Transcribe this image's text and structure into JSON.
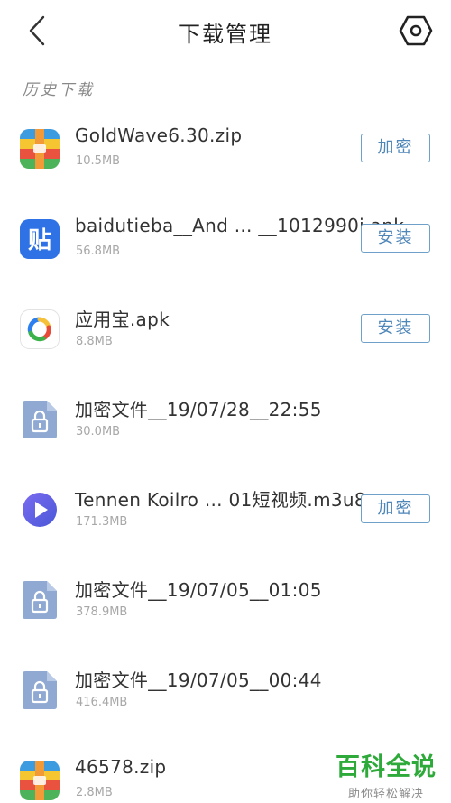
{
  "header": {
    "title": "下载管理",
    "back_icon": "chevron-left-icon",
    "settings_icon": "hexagon-settings-icon"
  },
  "section": {
    "label": "历史下载"
  },
  "files": [
    {
      "name": "GoldWave6.30.zip",
      "size": "10.5MB",
      "icon": "archive-icon",
      "action": "加密"
    },
    {
      "name": "baidutieba__And ... __1012990i.apk",
      "size": "56.8MB",
      "icon": "tieba-icon",
      "action": "安装"
    },
    {
      "name": "应用宝.apk",
      "size": "8.8MB",
      "icon": "yingyongbao-icon",
      "action": "安装"
    },
    {
      "name": "加密文件__19/07/28__22:55",
      "size": "30.0MB",
      "icon": "locked-file-icon",
      "action": ""
    },
    {
      "name": "Tennen Koilro ... 01短视频.m3u8",
      "size": "171.3MB",
      "icon": "video-play-icon",
      "action": "加密"
    },
    {
      "name": "加密文件__19/07/05__01:05",
      "size": "378.9MB",
      "icon": "locked-file-icon",
      "action": ""
    },
    {
      "name": "加密文件__19/07/05__00:44",
      "size": "416.4MB",
      "icon": "locked-file-icon",
      "action": ""
    },
    {
      "name": "46578.zip",
      "size": "2.8MB",
      "icon": "archive-icon",
      "action": ""
    }
  ],
  "watermark": {
    "title": "百科全说",
    "subtitle": "助你轻松解决"
  },
  "colors": {
    "button_border": "#6fa0c9",
    "button_text": "#4f86b8",
    "watermark_green": "#2eaa3a"
  }
}
